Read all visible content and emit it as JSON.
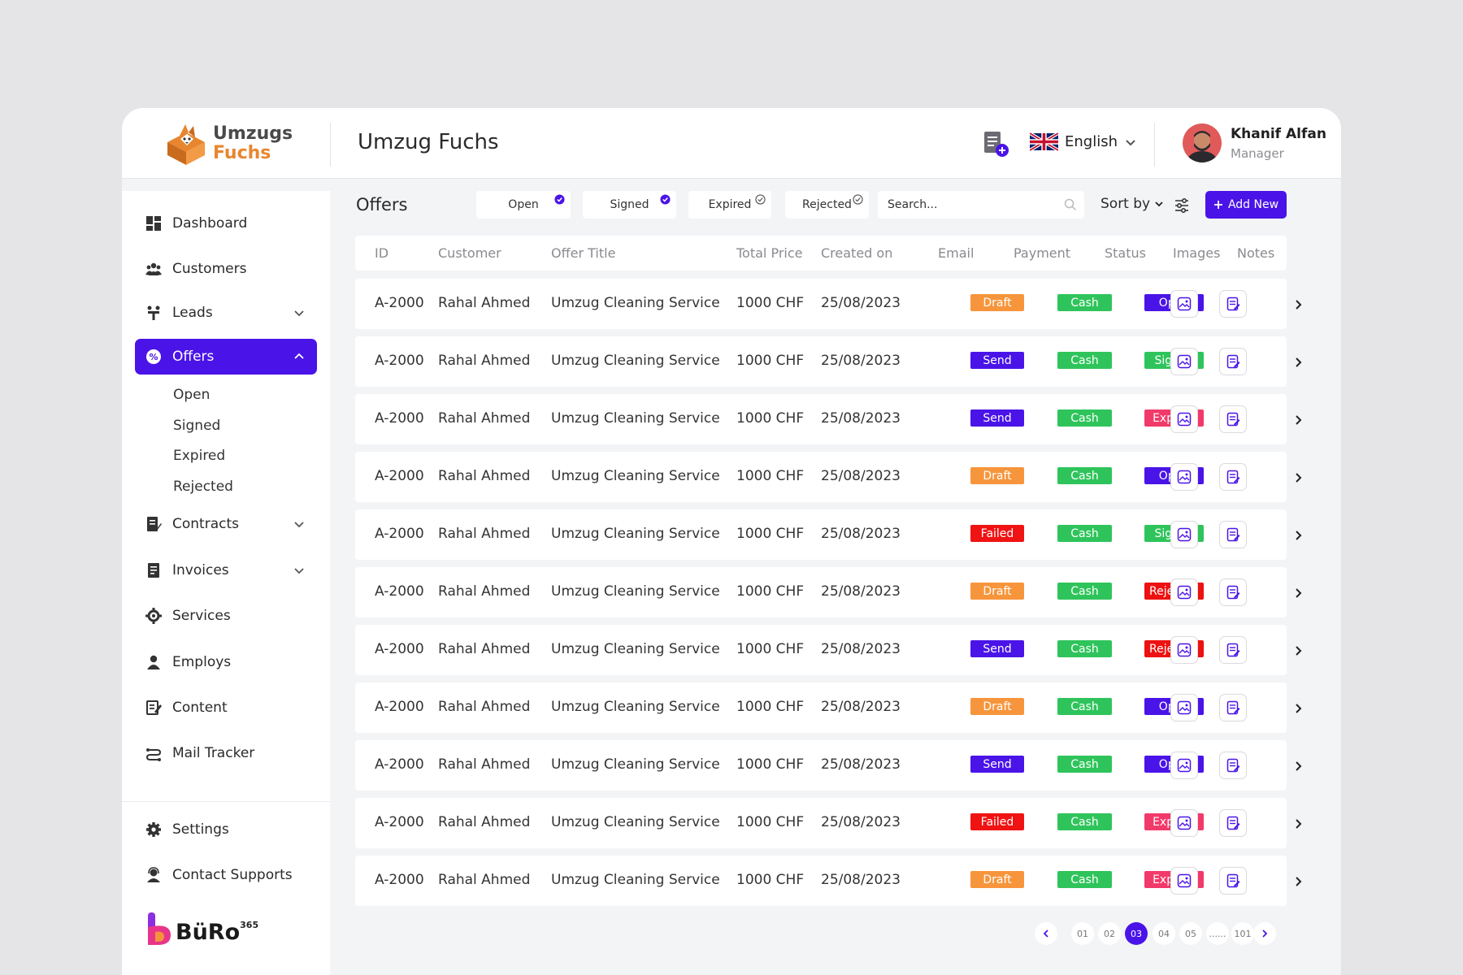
{
  "brand": {
    "line1": "Umzugs",
    "line2": "Fuchs"
  },
  "header": {
    "title": "Umzug Fuchs",
    "language": "English"
  },
  "user": {
    "name": "Khanif Alfan",
    "role": "Manager"
  },
  "sidebar": {
    "items": [
      {
        "label": "Dashboard",
        "icon": "dashboard-icon"
      },
      {
        "label": "Customers",
        "icon": "customers-icon"
      },
      {
        "label": "Leads",
        "icon": "leads-icon"
      },
      {
        "label": "Offers",
        "icon": "offers-icon"
      },
      {
        "label": "Contracts",
        "icon": "contracts-icon"
      },
      {
        "label": "Invoices",
        "icon": "invoices-icon"
      },
      {
        "label": "Services",
        "icon": "services-icon"
      },
      {
        "label": "Employs",
        "icon": "employs-icon"
      },
      {
        "label": "Content",
        "icon": "content-icon"
      },
      {
        "label": "Mail Tracker",
        "icon": "mail-tracker-icon"
      }
    ],
    "offer_sub": [
      "Open",
      "Signed",
      "Expired",
      "Rejected"
    ],
    "bottom": [
      {
        "label": "Settings",
        "icon": "settings-icon"
      },
      {
        "label": "Contact Supports",
        "icon": "support-icon"
      }
    ],
    "footer_brand": {
      "name": "BüRo",
      "sup": "365"
    }
  },
  "main": {
    "title": "Offers",
    "filters": [
      "Open",
      "Signed",
      "Expired",
      "Rejected"
    ],
    "search_placeholder": "Search...",
    "sort_label": "Sort by",
    "add_new": "Add New",
    "columns": [
      "ID",
      "Customer",
      "Offer Title",
      "Total Price",
      "Created on",
      "Email",
      "Payment",
      "Status",
      "Images",
      "Notes"
    ],
    "rows": [
      {
        "id": "A-2000",
        "customer": "Rahal Ahmed",
        "title": "Umzug Cleaning Service",
        "price": "1000 CHF",
        "created": "25/08/2023",
        "email": "Draft",
        "payment": "Cash",
        "status": "Open"
      },
      {
        "id": "A-2000",
        "customer": "Rahal Ahmed",
        "title": "Umzug Cleaning Service",
        "price": "1000 CHF",
        "created": "25/08/2023",
        "email": "Send",
        "payment": "Cash",
        "status": "Signed"
      },
      {
        "id": "A-2000",
        "customer": "Rahal Ahmed",
        "title": "Umzug Cleaning Service",
        "price": "1000 CHF",
        "created": "25/08/2023",
        "email": "Send",
        "payment": "Cash",
        "status": "Expired"
      },
      {
        "id": "A-2000",
        "customer": "Rahal Ahmed",
        "title": "Umzug Cleaning Service",
        "price": "1000 CHF",
        "created": "25/08/2023",
        "email": "Draft",
        "payment": "Cash",
        "status": "Open"
      },
      {
        "id": "A-2000",
        "customer": "Rahal Ahmed",
        "title": "Umzug Cleaning Service",
        "price": "1000 CHF",
        "created": "25/08/2023",
        "email": "Failed",
        "payment": "Cash",
        "status": "Signed"
      },
      {
        "id": "A-2000",
        "customer": "Rahal Ahmed",
        "title": "Umzug Cleaning Service",
        "price": "1000 CHF",
        "created": "25/08/2023",
        "email": "Draft",
        "payment": "Cash",
        "status": "Rejected"
      },
      {
        "id": "A-2000",
        "customer": "Rahal Ahmed",
        "title": "Umzug Cleaning Service",
        "price": "1000 CHF",
        "created": "25/08/2023",
        "email": "Send",
        "payment": "Cash",
        "status": "Rejected"
      },
      {
        "id": "A-2000",
        "customer": "Rahal Ahmed",
        "title": "Umzug Cleaning Service",
        "price": "1000 CHF",
        "created": "25/08/2023",
        "email": "Draft",
        "payment": "Cash",
        "status": "Open"
      },
      {
        "id": "A-2000",
        "customer": "Rahal Ahmed",
        "title": "Umzug Cleaning Service",
        "price": "1000 CHF",
        "created": "25/08/2023",
        "email": "Send",
        "payment": "Cash",
        "status": "Open"
      },
      {
        "id": "A-2000",
        "customer": "Rahal Ahmed",
        "title": "Umzug Cleaning Service",
        "price": "1000 CHF",
        "created": "25/08/2023",
        "email": "Failed",
        "payment": "Cash",
        "status": "Expired"
      },
      {
        "id": "A-2000",
        "customer": "Rahal Ahmed",
        "title": "Umzug Cleaning Service",
        "price": "1000 CHF",
        "created": "25/08/2023",
        "email": "Draft",
        "payment": "Cash",
        "status": "Expired"
      }
    ],
    "pagination": [
      "01",
      "02",
      "03",
      "04",
      "05",
      "......",
      "101"
    ],
    "current_page": "03"
  },
  "colors": {
    "accent": "#4a14e8",
    "Draft": "#f7953c",
    "Send": "#4a14e8",
    "Failed": "#f01313",
    "Cash": "#2fc45b",
    "Open": "#4a14e8",
    "Signed": "#2fc45b",
    "Expired": "#f23a6a",
    "Rejected": "#ee1111"
  }
}
